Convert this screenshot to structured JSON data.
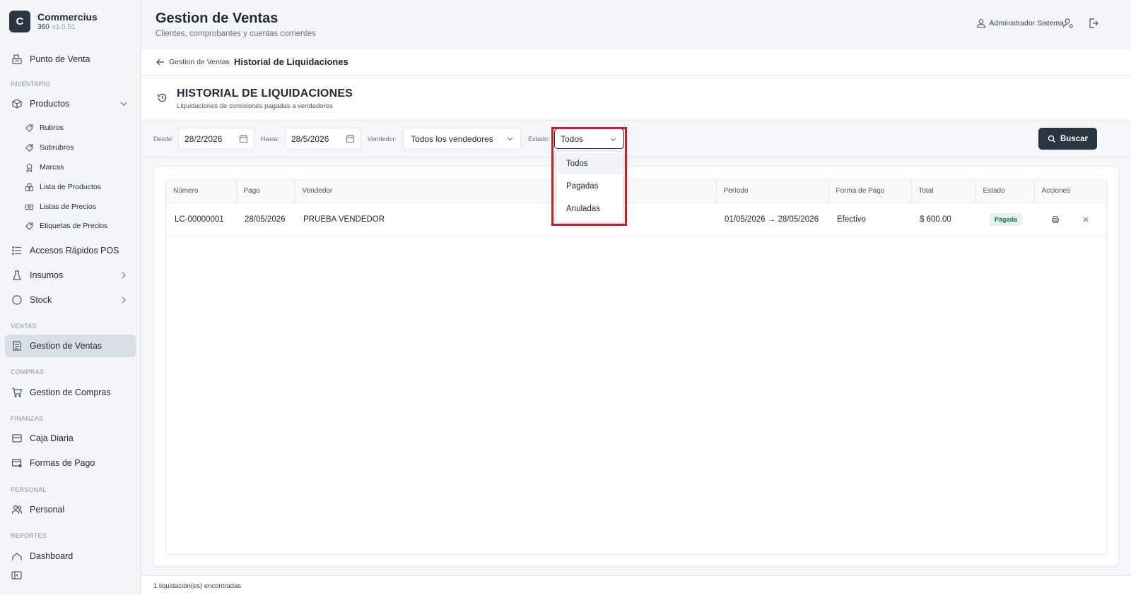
{
  "brand": {
    "logo_letter": "C",
    "name": "Commercius",
    "sub": "360",
    "version": "v1.0.51"
  },
  "sidebar": {
    "pos": "Punto de Venta",
    "section_inventario": "INVENTARIO",
    "productos": "Productos",
    "sub_items": [
      "Rubros",
      "Subrubros",
      "Marcas",
      "Lista de Productos",
      "Listas de Precios",
      "Etiquetas de Precios"
    ],
    "accesos": "Accesos Rápidos POS",
    "insumos": "Insumos",
    "stock": "Stock",
    "section_ventas": "VENTAS",
    "gestion_ventas": "Gestion de Ventas",
    "section_compras": "COMPRAS",
    "gestion_compras": "Gestion de Compras",
    "section_finanzas": "FINANZAS",
    "caja": "Caja Diaria",
    "formas_pago": "Formas de Pago",
    "section_personal": "PERSONAL",
    "personal": "Personal",
    "section_reportes": "REPORTES",
    "dashboard": "Dashboard"
  },
  "header": {
    "title": "Gestion de Ventas",
    "subtitle": "Clientes, comprobantes y cuentas corrientes",
    "user": "Administrador Sistema"
  },
  "breadcrumb": {
    "back": "Gestion de Ventas",
    "current": "Historial de Liquidaciones"
  },
  "section": {
    "title": "HISTORIAL DE LIQUIDACIONES",
    "subtitle": "Liquidaciones de comisiones pagadas a vendedores"
  },
  "filters": {
    "desde_label": "Desde:",
    "desde_value": "28/2/2026",
    "hasta_label": "Hasta:",
    "hasta_value": "28/5/2026",
    "vendedor_label": "Vendedor:",
    "vendedor_value": "Todos los vendedores",
    "estado_label": "Estado:",
    "estado_value": "Todos",
    "buscar": "Buscar"
  },
  "dropdown": {
    "options": [
      "Todos",
      "Pagadas",
      "Anuladas"
    ]
  },
  "table": {
    "headers": [
      "Número",
      "Pago",
      "Vendedor",
      "Período",
      "Forma de Pago",
      "Total",
      "Estado",
      "Acciones"
    ],
    "rows": [
      {
        "numero": "LC-00000001",
        "pago": "28/05/2026",
        "vendedor": "PRUEBA VENDEDOR",
        "periodo": "01/05/2026 → 28/05/2026",
        "forma": "Efectivo",
        "total": "$ 600.00",
        "estado": "Pagada"
      }
    ]
  },
  "footer": "1 liquidación(es) encontradas",
  "colors": {
    "accent": "#2b3441",
    "highlight": "#d11a2a",
    "badge_bg": "#e3f5ea",
    "badge_fg": "#177245"
  }
}
